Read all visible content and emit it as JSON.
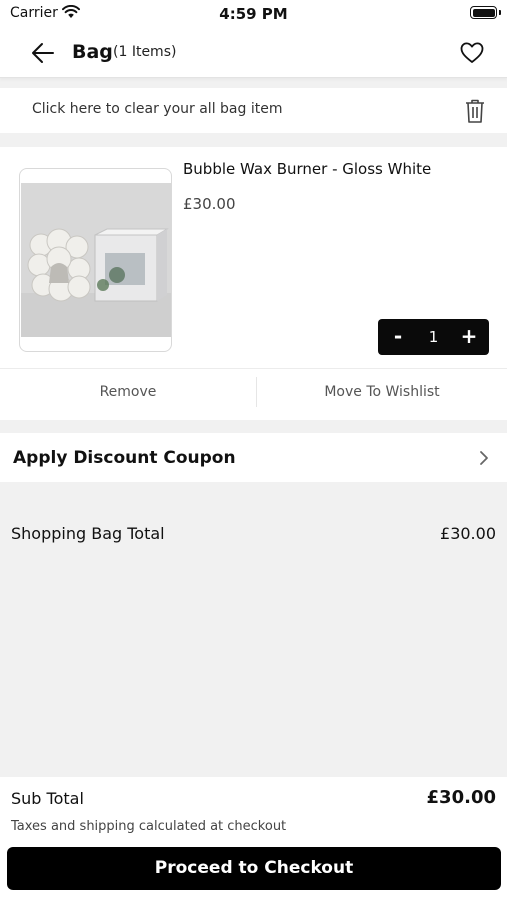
{
  "status_bar": {
    "carrier": "Carrier",
    "time": "4:59 PM"
  },
  "nav": {
    "title": "Bag",
    "count": "(1 Items)",
    "back_icon": "back-arrow-icon",
    "wishlist_icon": "heart-icon"
  },
  "clear_bag": {
    "label": "Click here to clear your all bag item",
    "icon": "trash-icon"
  },
  "cart_items": [
    {
      "name": "Bubble Wax Burner - Gloss White",
      "price": "£30.00",
      "quantity": "1",
      "decrement_label": "-",
      "increment_label": "+",
      "remove_label": "Remove",
      "wishlist_label": "Move To Wishlist"
    }
  ],
  "coupon": {
    "label": "Apply Discount Coupon",
    "icon": "chevron-right-icon"
  },
  "totals": {
    "bag_total_label": "Shopping Bag Total",
    "bag_total_value": "£30.00"
  },
  "footer": {
    "subtotal_label": "Sub Total",
    "subtotal_value": "£30.00",
    "tax_note": "Taxes and shipping calculated at checkout",
    "checkout_label": "Proceed to Checkout"
  },
  "colors": {
    "background": "#f1f1f1",
    "surface": "#ffffff",
    "primary_button": "#000000",
    "primary_text": "#111111"
  }
}
